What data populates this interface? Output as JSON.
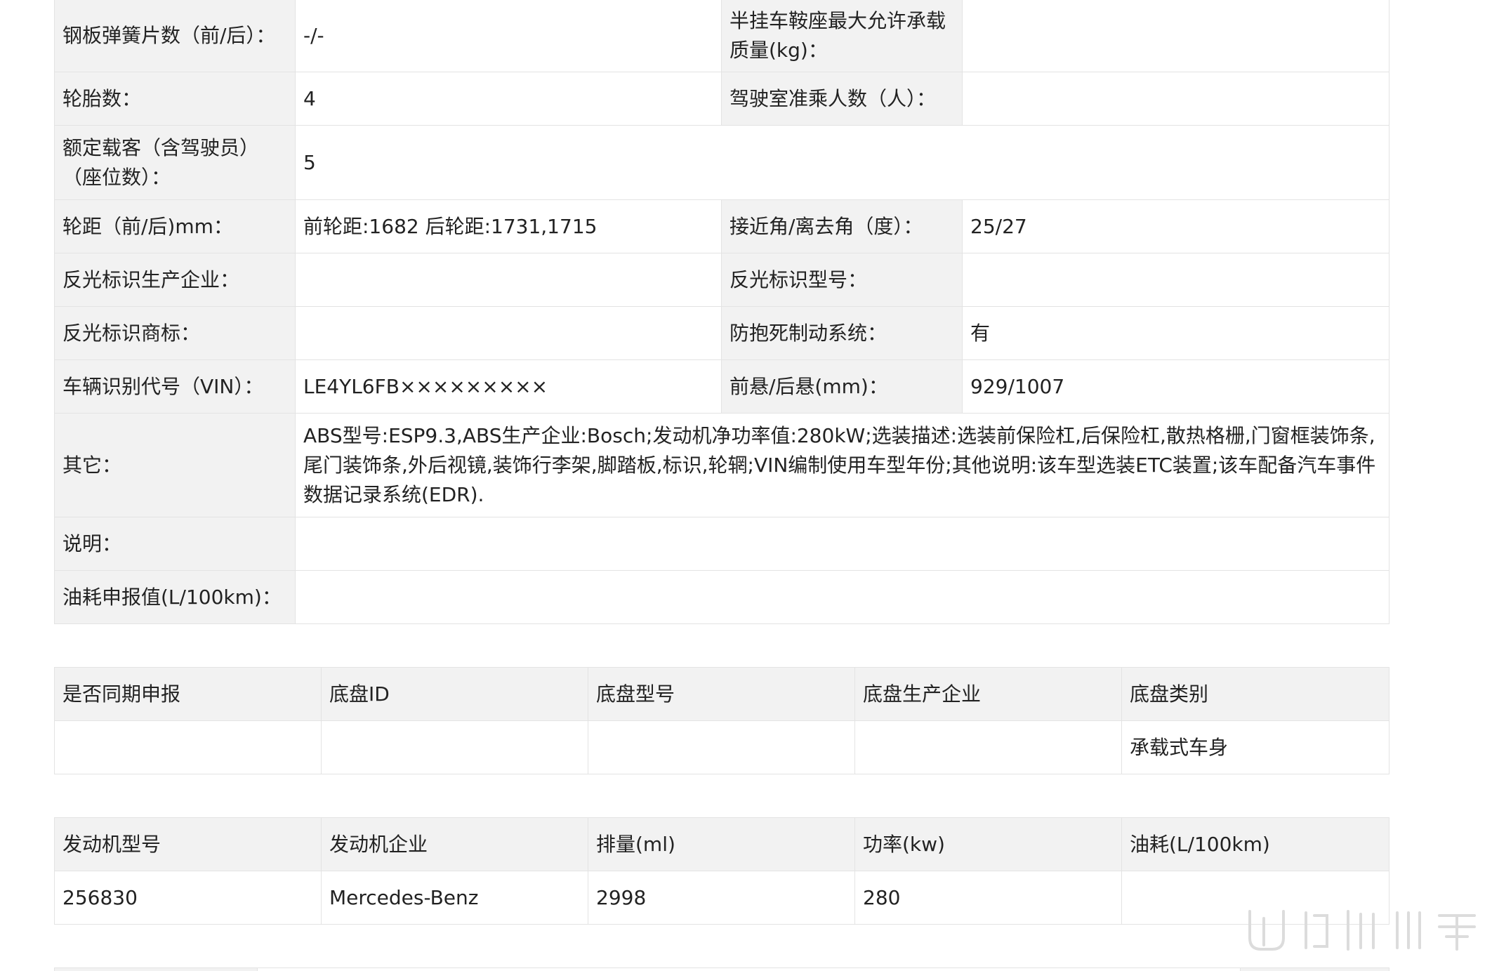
{
  "spec_table": {
    "rows": [
      {
        "label1": "钢板弹簧片数（前/后）：",
        "value1": "-/-",
        "label2": "半挂车鞍座最大允许承载质量(kg)：",
        "value2": ""
      },
      {
        "label1": "轮胎数：",
        "value1": "4",
        "label2": "驾驶室准乘人数（人）：",
        "value2": ""
      },
      {
        "label1": "额定载客（含驾驶员）（座位数）：",
        "value1": "5"
      },
      {
        "label1": "轮距（前/后)mm：",
        "value1": "前轮距:1682 后轮距:1731,1715",
        "label2": "接近角/离去角（度）：",
        "value2": "25/27"
      },
      {
        "label1": "反光标识生产企业：",
        "value1": "",
        "label2": "反光标识型号：",
        "value2": ""
      },
      {
        "label1": "反光标识商标：",
        "value1": "",
        "label2": "防抱死制动系统：",
        "value2": "有"
      },
      {
        "label1": "车辆识别代号（VIN）：",
        "value1": "LE4YL6FB×××××××××",
        "label2": "前悬/后悬(mm)：",
        "value2": "929/1007"
      },
      {
        "label1": "其它：",
        "value1": "ABS型号:ESP9.3,ABS生产企业:Bosch;发动机净功率值:280kW;选装描述:选装前保险杠,后保险杠,散热格栅,门窗框装饰条,尾门装饰条,外后视镜,装饰行李架,脚踏板,标识,轮辋;VIN编制使用车型年份;其他说明:该车型选装ETC装置;该车配备汽车事件数据记录系统(EDR)."
      },
      {
        "label1": "说明：",
        "value1": ""
      },
      {
        "label1": "油耗申报值(L/100km)：",
        "value1": ""
      }
    ]
  },
  "chassis_table": {
    "headers": [
      "是否同期申报",
      "底盘ID",
      "底盘型号",
      "底盘生产企业",
      "底盘类别"
    ],
    "row": [
      "",
      "",
      "",
      "",
      "承载式车身"
    ]
  },
  "engine_table": {
    "headers": [
      "发动机型号",
      "发动机企业",
      "排量(ml)",
      "功率(kw)",
      "油耗(L/100km)"
    ],
    "row": [
      "256830",
      "Mercedes-Benz",
      "2998",
      "280",
      ""
    ]
  },
  "colors": {
    "label_bg": "#f2f2f2",
    "border": "#e3e3e3",
    "text": "#222222"
  }
}
